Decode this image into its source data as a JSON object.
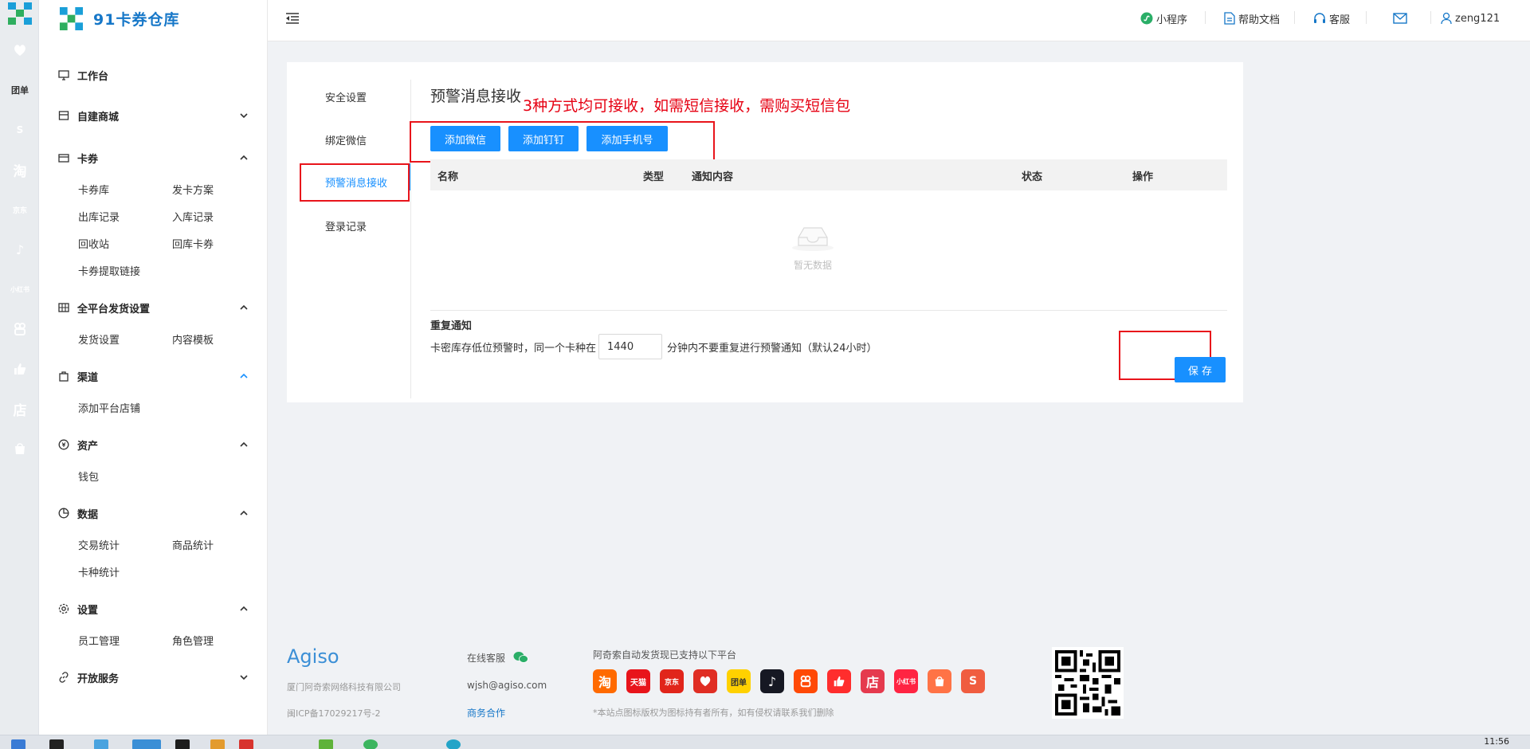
{
  "rail": {
    "icons": [
      {
        "name": "pinduoduo-icon",
        "text": "",
        "color": "#e02e24"
      },
      {
        "name": "meituan-icon",
        "text": "团单",
        "color": "#ffd100"
      },
      {
        "name": "shopee-icon",
        "text": "S",
        "color": "#f05d40"
      },
      {
        "name": "taobao-icon",
        "text": "淘",
        "color": "#ff7a35"
      },
      {
        "name": "jd-icon",
        "text": "京东",
        "color": "#e1251b"
      },
      {
        "name": "douyin-icon",
        "text": "♪",
        "color": "#161823"
      },
      {
        "name": "xiaohongshu-icon",
        "text": "小红书",
        "color": "#ff2442"
      },
      {
        "name": "kuaishou-icon",
        "text": "",
        "color": "#ff5000"
      },
      {
        "name": "thumbs-up-icon",
        "text": "",
        "color": "#ff3b30"
      },
      {
        "name": "dian-icon",
        "text": "店",
        "color": "#e53a4e"
      },
      {
        "name": "shop-bag-icon",
        "text": "",
        "color": "#ff7346"
      }
    ]
  },
  "brand": {
    "name": "91卡券仓库"
  },
  "sidebar": {
    "workbench": "工作台",
    "mall": "自建商城",
    "cards": {
      "title": "卡券",
      "items": [
        "卡券库",
        "发卡方案",
        "出库记录",
        "入库记录",
        "回收站",
        "回库卡券",
        "卡券提取链接"
      ]
    },
    "delivery": {
      "title": "全平台发货设置",
      "items": [
        "发货设置",
        "内容模板"
      ]
    },
    "channel": {
      "title": "渠道",
      "items": [
        "添加平台店铺"
      ]
    },
    "assets": {
      "title": "资产",
      "items": [
        "钱包"
      ]
    },
    "data": {
      "title": "数据",
      "items": [
        "交易统计",
        "商品统计",
        "卡种统计"
      ]
    },
    "settings": {
      "title": "设置",
      "items": [
        "员工管理",
        "角色管理"
      ]
    },
    "open": "开放服务"
  },
  "header": {
    "miniprogram": "小程序",
    "docs": "帮助文档",
    "service": "客服",
    "username": "zeng121"
  },
  "tabs": [
    "安全设置",
    "绑定微信",
    "预警消息接收",
    "登录记录"
  ],
  "main": {
    "title": "预警消息接收",
    "annotation": "3种方式均可接收，如需短信接收，需购买短信包",
    "buttons": {
      "wechat": "添加微信",
      "dingtalk": "添加钉钉",
      "phone": "添加手机号"
    },
    "columns": [
      "名称",
      "类型",
      "通知内容",
      "状态",
      "操作"
    ],
    "empty": "暂无数据",
    "repeat": {
      "title": "重复通知",
      "before": "卡密库存低位预警时，同一个卡种在",
      "value": "1440",
      "after": "分钟内不要重复进行预警通知（默认24小时）"
    },
    "save": "保 存"
  },
  "footer": {
    "logo": "Agiso",
    "company": "厦门阿奇索网络科技有限公司",
    "icp": "闽ICP备17029217号-2",
    "online": "在线客服",
    "email": "wjsh@agiso.com",
    "biz": "商务合作",
    "platforms_title": "阿奇索自动发货现已支持以下平台",
    "disclaimer": "*本站点图标版权为图标持有者所有，如有侵权请联系我们删除",
    "platforms": [
      {
        "name": "taobao-icon",
        "text": "淘",
        "color": "#ff6a00"
      },
      {
        "name": "tmall-icon",
        "text": "天猫",
        "color": "#e8141b"
      },
      {
        "name": "jd-icon",
        "text": "京东",
        "color": "#e1251b"
      },
      {
        "name": "pinduoduo-icon",
        "text": "",
        "color": "#e02e24"
      },
      {
        "name": "meituan-icon",
        "text": "团单",
        "color": "#ffd100"
      },
      {
        "name": "douyin-icon",
        "text": "♪",
        "color": "#161823"
      },
      {
        "name": "kuaishou-icon",
        "text": "",
        "color": "#ff4906"
      },
      {
        "name": "thumbs-up-icon",
        "text": "",
        "color": "#ff2d2d"
      },
      {
        "name": "dian-icon",
        "text": "店",
        "color": "#e53a4e"
      },
      {
        "name": "xiaohongshu-icon",
        "text": "小红书",
        "color": "#ff2442"
      },
      {
        "name": "shop-bag-icon",
        "text": "",
        "color": "#ff7346"
      },
      {
        "name": "shopee-icon",
        "text": "S",
        "color": "#f05d40"
      }
    ]
  },
  "taskbar": {
    "time": "11:56"
  },
  "colors": {
    "primary": "#1890ff",
    "annotation": "#e60012",
    "brand": "#1677c8"
  }
}
